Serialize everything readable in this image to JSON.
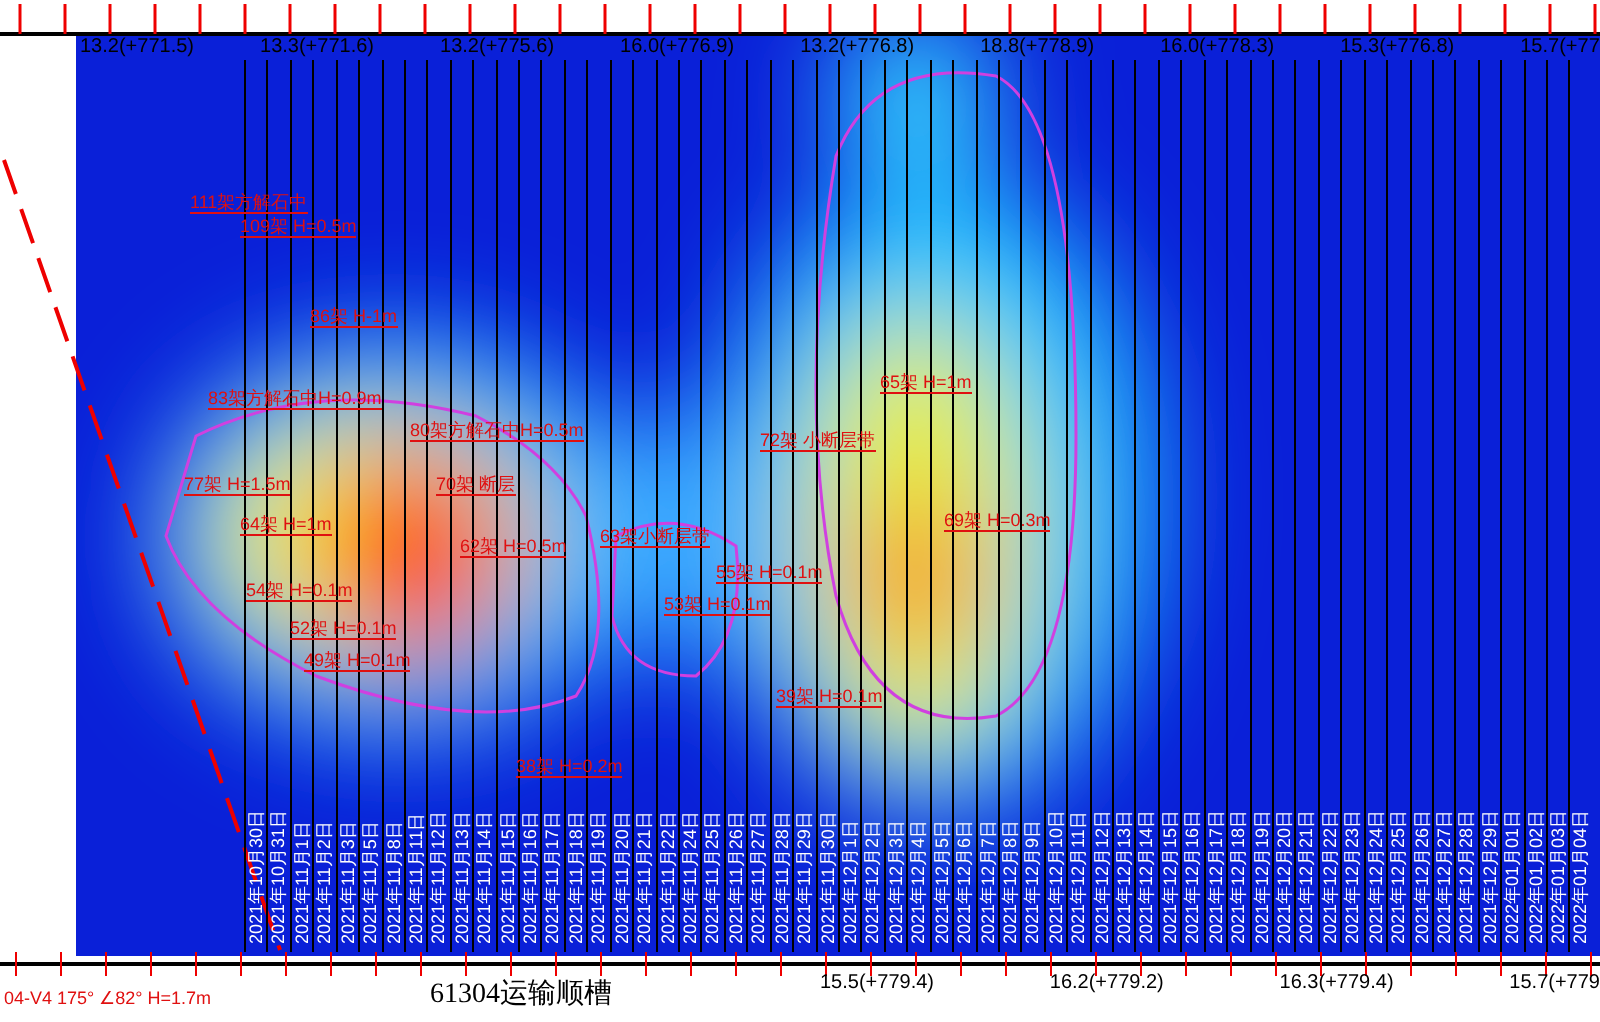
{
  "top_labels": [
    "13.2(+771.5)",
    "13.3(+771.6)",
    "13.2(+775.6)",
    "16.0(+776.9)",
    "13.2(+776.8)",
    "18.8(+778.9)",
    "16.0(+778.3)",
    "15.3(+776.8)",
    "15.7(+77"
  ],
  "annotations": [
    {
      "text": "111架方解石中"
    },
    {
      "text": "109架 H=0.5m"
    },
    {
      "text": "86架 H-1m"
    },
    {
      "text": "83架方解石中H=0.9m"
    },
    {
      "text": "80架方解石中H=0.5m"
    },
    {
      "text": "77架 H=1.5m"
    },
    {
      "text": "64架 H=1m"
    },
    {
      "text": "54架 H=0.1m"
    },
    {
      "text": "52架 H=0.1m"
    },
    {
      "text": "49架 H=0.1m"
    },
    {
      "text": "70架 断层"
    },
    {
      "text": "62架 H=0.5m"
    },
    {
      "text": "65架 H=1m"
    },
    {
      "text": "69架 H=0.3m"
    },
    {
      "text": "72架 小断层带"
    },
    {
      "text": "63架小断层带"
    },
    {
      "text": "55架 H=0.1m"
    },
    {
      "text": "53架 H=0.1m"
    },
    {
      "text": "39架 H=0.1m"
    },
    {
      "text": "38架 H=0.2m"
    }
  ],
  "dates": [
    "2021年10月30日",
    "2021年10月31日",
    "2021年11月1日",
    "2021年11月2日",
    "2021年11月3日",
    "2021年11月5日",
    "2021年11月8日",
    "2021年11月11日",
    "2021年11月12日",
    "2021年11月13日",
    "2021年11月14日",
    "2021年11月15日",
    "2021年11月16日",
    "2021年11月17日",
    "2021年11月18日",
    "2021年11月19日",
    "2021年11月20日",
    "2021年11月21日",
    "2021年11月22日",
    "2021年11月24日",
    "2021年11月25日",
    "2021年11月26日",
    "2021年11月27日",
    "2021年11月28日",
    "2021年11月29日",
    "2021年11月30日",
    "2021年12月1日",
    "2021年12月2日",
    "2021年12月3日",
    "2021年12月4日",
    "2021年12月5日",
    "2021年12月6日",
    "2021年12月7日",
    "2021年12月8日",
    "2021年12月9日",
    "2021年12月10日",
    "2021年12月11日",
    "2021年12月12日",
    "2021年12月13日",
    "2021年12月14日",
    "2021年12月15日",
    "2021年12月16日",
    "2021年12月17日",
    "2021年12月18日",
    "2021年12月19日",
    "2021年12月20日",
    "2021年12月21日",
    "2021年12月22日",
    "2021年12月23日",
    "2021年12月24日",
    "2021年12月25日",
    "2021年12月26日",
    "2021年12月27日",
    "2021年12月28日",
    "2021年12月29日",
    "2022年01月01日",
    "2022年01月02日",
    "2022年01月03日",
    "2022年01月04日"
  ],
  "bottom_labels": [
    "15.5(+779.4)",
    "16.2(+779.2)",
    "16.3(+779.4)",
    "15.7(+779"
  ],
  "roadway_label": "61304运输顺槽",
  "fault_label": "04-V4 175° ∠82° H=1.7m"
}
